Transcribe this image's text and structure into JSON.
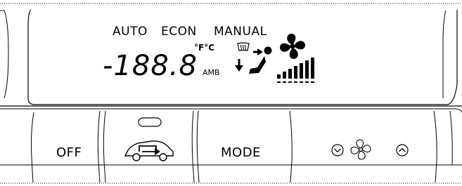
{
  "display": {
    "modes": {
      "auto": "AUTO",
      "econ": "ECON",
      "manual": "MANUAL"
    },
    "temperature": {
      "value": "-188.8",
      "units": "°F°C",
      "ambient_label": "AMB"
    },
    "icons": [
      "defrost-icon",
      "airflow-direction-icon",
      "fan-icon",
      "fan-speed-bars-icon"
    ],
    "fan_speed_bars": 7
  },
  "buttons": {
    "off_label": "OFF",
    "recirculation_icon": "recirculation-car-icon",
    "mode_label": "MODE",
    "fan_down_icon": "chevron-down-icon",
    "fan_icon": "fan-icon",
    "fan_up_icon": "chevron-up-icon"
  }
}
